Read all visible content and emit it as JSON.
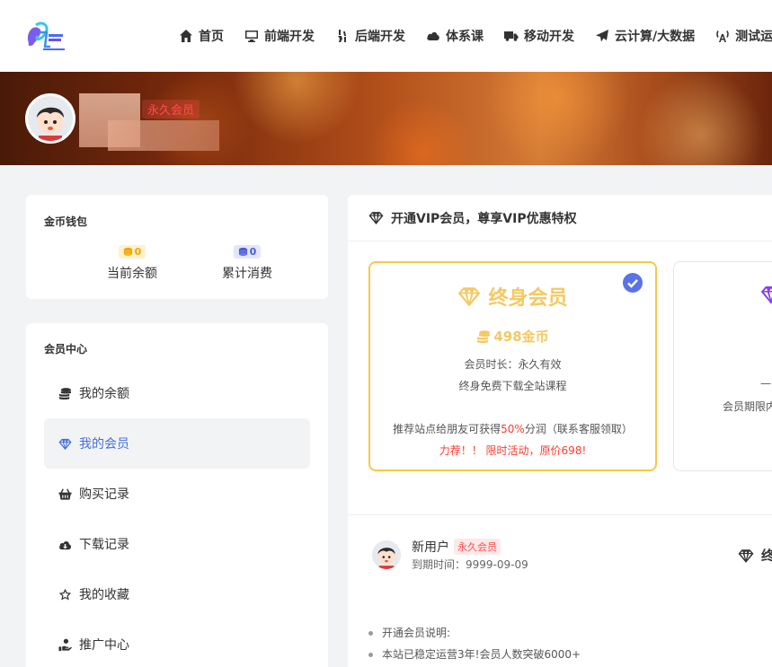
{
  "nav": {
    "items": [
      {
        "label": "首页",
        "icon": "home-icon"
      },
      {
        "label": "前端开发",
        "icon": "monitor-icon"
      },
      {
        "label": "后端开发",
        "icon": "server-icon"
      },
      {
        "label": "体系课",
        "icon": "cloud-icon"
      },
      {
        "label": "移动开发",
        "icon": "truck-icon"
      },
      {
        "label": "云计算/大数据",
        "icon": "send-icon"
      },
      {
        "label": "测试运",
        "icon": "antenna-icon"
      }
    ]
  },
  "banner": {
    "vip_badge": "永久会员"
  },
  "wallet": {
    "title": "金币钱包",
    "balance": {
      "value": "0",
      "label": "当前余额"
    },
    "spent": {
      "value": "0",
      "label": "累计消费"
    }
  },
  "member_center": {
    "title": "会员中心",
    "items": [
      {
        "label": "我的余额",
        "icon": "coins-icon",
        "active": false
      },
      {
        "label": "我的会员",
        "icon": "diamond-icon",
        "active": true
      },
      {
        "label": "购买记录",
        "icon": "basket-icon",
        "active": false
      },
      {
        "label": "下载记录",
        "icon": "cloud-download-icon",
        "active": false
      },
      {
        "label": "我的收藏",
        "icon": "star-icon",
        "active": false
      },
      {
        "label": "推广中心",
        "icon": "hand-coin-icon",
        "active": false
      }
    ]
  },
  "main": {
    "header": "开通VIP会员，尊享VIP优惠特权",
    "plan": {
      "title": "终身会员",
      "price": "498金币",
      "duration": "会员时长：永久有效",
      "benefit": "终身免费下载全站课程",
      "referral_prefix": "推荐站点给朋友可获得",
      "referral_percent": "50%",
      "referral_suffix": "分润（联系客服领取）",
      "promo": "力荐！！ 限时活动，原价698!"
    },
    "plan2": {
      "line1": "—",
      "line2": "会员期限内"
    },
    "user": {
      "name": "新用户",
      "vip": "永久会员",
      "expire": "到期时间：9999-09-09"
    },
    "right_hint": "终",
    "notes": [
      "开通会员说明:",
      "本站已稳定运营3年!会员人数突破6000+"
    ]
  },
  "colors": {
    "accent_blue": "#4770d8",
    "gold": "#f6c861",
    "vip_red": "#ff4d4f",
    "check_blue": "#5b73e8"
  }
}
